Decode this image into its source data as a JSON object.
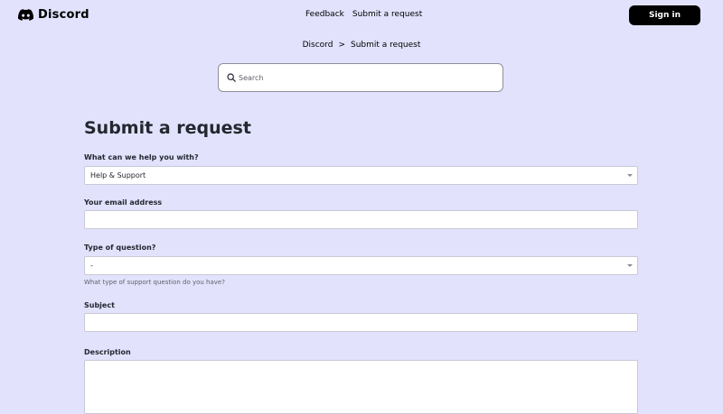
{
  "header": {
    "logo_text": "Discord",
    "nav": {
      "feedback": "Feedback",
      "submit_request": "Submit a request"
    },
    "signin_label": "Sign in"
  },
  "breadcrumb": {
    "root": "Discord",
    "separator": ">",
    "current": "Submit a request"
  },
  "search": {
    "placeholder": "Search"
  },
  "form": {
    "title": "Submit a request",
    "help_with": {
      "label": "What can we help you with?",
      "value": "Help & Support"
    },
    "email": {
      "label": "Your email address",
      "value": ""
    },
    "question_type": {
      "label": "Type of question?",
      "value": "-",
      "hint": "What type of support question do you have?"
    },
    "subject": {
      "label": "Subject",
      "value": ""
    },
    "description": {
      "label": "Description",
      "value": ""
    }
  },
  "colors": {
    "background": "#e2e2fd",
    "button": "#000000",
    "field_border": "#c9c9d6",
    "text": "#23272f"
  },
  "icons": [
    "discord-logo-icon",
    "search-icon",
    "chevron-down-icon"
  ]
}
